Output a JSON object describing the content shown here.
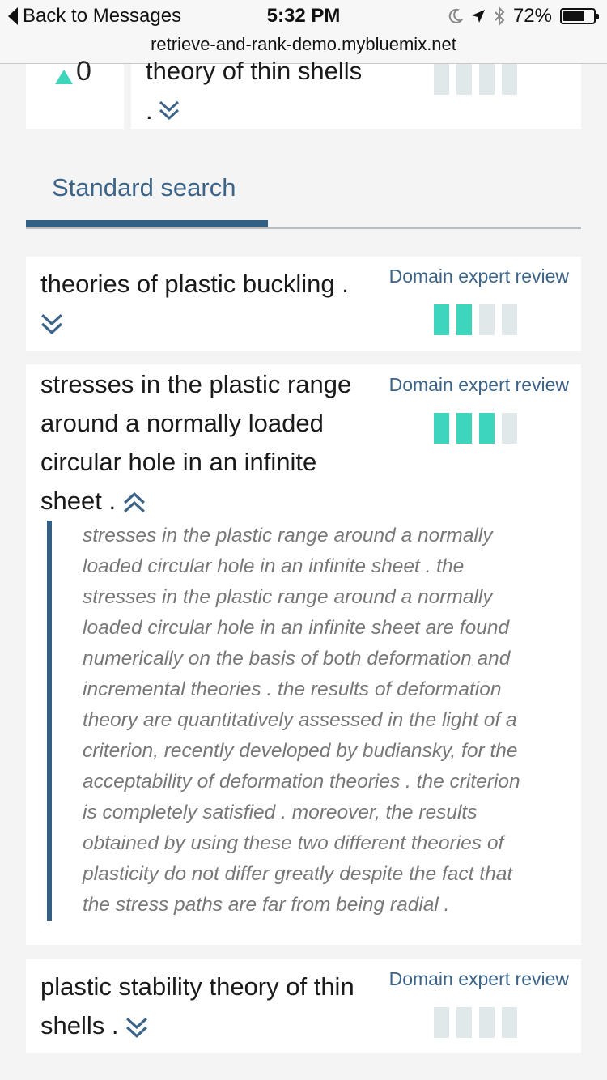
{
  "status_bar": {
    "back_label": "Back to Messages",
    "time": "5:32 PM",
    "battery": "72%",
    "battery_level": 0.72,
    "icons": [
      "moon-icon",
      "location-arrow-icon",
      "bluetooth-icon",
      "battery-icon"
    ]
  },
  "browser": {
    "url": "retrieve-and-rank-demo.mybluemix.net"
  },
  "top_result": {
    "vote_count": "0",
    "title": "theory of thin shells",
    "period": ".",
    "rank_level": 0
  },
  "tabs": [
    {
      "label": "Standard search",
      "active": true
    }
  ],
  "results": [
    {
      "title": "theories of plastic buckling .",
      "review_label": "Domain expert review",
      "rank_level": 2,
      "expanded": false
    },
    {
      "title_lines": [
        "stresses in the plastic range",
        "around a normally loaded",
        "circular hole in an infinite",
        "sheet ."
      ],
      "review_label": "Domain expert review",
      "rank_level": 3,
      "expanded": true,
      "abstract_lines": [
        "stresses in the plastic range around a normally",
        "loaded circular hole in an infinite sheet . the",
        "stresses in the plastic range around a normally",
        "loaded circular hole in an infinite sheet are found",
        "numerically on the basis of both deformation and",
        "incremental theories . the results of deformation",
        "theory are quantitatively assessed in the light of a",
        "criterion, recently developed by budiansky, for the",
        "acceptability of deformation theories . the criterion",
        "is completely satisfied . moreover, the results",
        "obtained by using these two different theories of",
        "plasticity do not differ greatly despite the fact that",
        "the stress paths are far from being radial ."
      ]
    },
    {
      "title_lines": [
        "plastic stability theory of thin",
        "shells ."
      ],
      "review_label": "Domain expert review",
      "rank_level": 0,
      "expanded": false
    }
  ],
  "colors": {
    "accent_teal": "#3dd6bd",
    "link_blue": "#3c6488",
    "tab_blue": "#325f84",
    "bar_empty": "#e1e8ea"
  }
}
